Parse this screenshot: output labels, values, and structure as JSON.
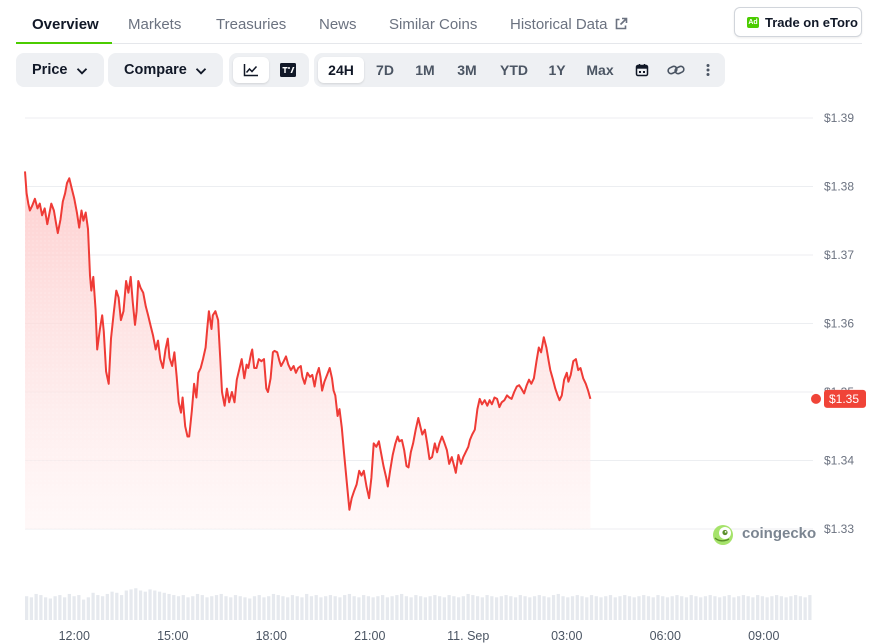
{
  "tabs": [
    {
      "label": "Overview",
      "active": true
    },
    {
      "label": "Markets",
      "active": false
    },
    {
      "label": "Treasuries",
      "active": false
    },
    {
      "label": "News",
      "active": false
    },
    {
      "label": "Similar Coins",
      "active": false
    },
    {
      "label": "Historical Data",
      "active": false
    }
  ],
  "ad_badge": "Ad",
  "cta_label": "Trade on eToro",
  "toolbar": {
    "price_label": "Price",
    "compare_label": "Compare",
    "chart_modes": [
      "line-chart-icon",
      "tradingview-icon"
    ],
    "ranges": [
      "24H",
      "7D",
      "1M",
      "3M",
      "YTD",
      "1Y",
      "Max"
    ],
    "active_range": "24H",
    "tools": [
      "calendar-icon",
      "link-icon",
      "more-icon"
    ]
  },
  "watermark": "coingecko",
  "colors": {
    "accent_green": "#4bcc00",
    "line_red": "#ef3b36",
    "badge_red": "#f04438"
  },
  "chart_data": {
    "type": "area",
    "current_price_label": "$1.35",
    "current_price": 1.349,
    "ylim": [
      1.33,
      1.39
    ],
    "y_ticks": [
      {
        "value": 1.39,
        "label": "$1.39"
      },
      {
        "value": 1.38,
        "label": "$1.38"
      },
      {
        "value": 1.37,
        "label": "$1.37"
      },
      {
        "value": 1.36,
        "label": "$1.36"
      },
      {
        "value": 1.35,
        "label": "$1.35"
      },
      {
        "value": 1.34,
        "label": "$1.34"
      },
      {
        "value": 1.33,
        "label": "$1.33"
      }
    ],
    "x_ticks": [
      {
        "t": 0.0,
        "label": "12:00"
      },
      {
        "t": 3.0,
        "label": "15:00"
      },
      {
        "t": 6.0,
        "label": "18:00"
      },
      {
        "t": 9.0,
        "label": "21:00"
      },
      {
        "t": 12.0,
        "label": "11. Sep"
      },
      {
        "t": 15.0,
        "label": "03:00"
      },
      {
        "t": 18.0,
        "label": "06:00"
      },
      {
        "t": 21.0,
        "label": "09:00"
      }
    ],
    "x_range": [
      -1.5,
      22.5
    ],
    "series": [
      {
        "values": [
          [
            -1.5,
            1.3822
          ],
          [
            -1.45,
            1.379
          ],
          [
            -1.4,
            1.3775
          ],
          [
            -1.35,
            1.3765
          ],
          [
            -1.28,
            1.3772
          ],
          [
            -1.2,
            1.3782
          ],
          [
            -1.12,
            1.3768
          ],
          [
            -1.05,
            1.3775
          ],
          [
            -0.98,
            1.3758
          ],
          [
            -0.9,
            1.3768
          ],
          [
            -0.82,
            1.3745
          ],
          [
            -0.76,
            1.376
          ],
          [
            -0.7,
            1.3775
          ],
          [
            -0.62,
            1.3765
          ],
          [
            -0.55,
            1.3745
          ],
          [
            -0.5,
            1.3732
          ],
          [
            -0.42,
            1.3752
          ],
          [
            -0.35,
            1.3778
          ],
          [
            -0.28,
            1.379
          ],
          [
            -0.22,
            1.3805
          ],
          [
            -0.15,
            1.3812
          ],
          [
            -0.08,
            1.3798
          ],
          [
            0.0,
            1.3782
          ],
          [
            0.08,
            1.3762
          ],
          [
            0.15,
            1.374
          ],
          [
            0.22,
            1.3765
          ],
          [
            0.28,
            1.375
          ],
          [
            0.35,
            1.3762
          ],
          [
            0.42,
            1.3738
          ],
          [
            0.48,
            1.367
          ],
          [
            0.52,
            1.3648
          ],
          [
            0.58,
            1.3668
          ],
          [
            0.65,
            1.362
          ],
          [
            0.7,
            1.3562
          ],
          [
            0.78,
            1.3592
          ],
          [
            0.85,
            1.3612
          ],
          [
            0.9,
            1.3588
          ],
          [
            0.97,
            1.353
          ],
          [
            1.05,
            1.3512
          ],
          [
            1.12,
            1.3578
          ],
          [
            1.2,
            1.3615
          ],
          [
            1.28,
            1.3648
          ],
          [
            1.35,
            1.3638
          ],
          [
            1.42,
            1.3605
          ],
          [
            1.5,
            1.3618
          ],
          [
            1.58,
            1.3662
          ],
          [
            1.65,
            1.3645
          ],
          [
            1.72,
            1.3668
          ],
          [
            1.78,
            1.3632
          ],
          [
            1.85,
            1.3598
          ],
          [
            1.9,
            1.3618
          ],
          [
            1.95,
            1.3662
          ],
          [
            2.02,
            1.3652
          ],
          [
            2.1,
            1.3645
          ],
          [
            2.18,
            1.3625
          ],
          [
            2.25,
            1.3612
          ],
          [
            2.32,
            1.3598
          ],
          [
            2.4,
            1.3582
          ],
          [
            2.48,
            1.3562
          ],
          [
            2.55,
            1.3575
          ],
          [
            2.62,
            1.3548
          ],
          [
            2.7,
            1.3535
          ],
          [
            2.78,
            1.3562
          ],
          [
            2.85,
            1.3578
          ],
          [
            2.9,
            1.355
          ],
          [
            2.98,
            1.3538
          ],
          [
            3.05,
            1.3558
          ],
          [
            3.12,
            1.3522
          ],
          [
            3.18,
            1.3485
          ],
          [
            3.25,
            1.347
          ],
          [
            3.3,
            1.3492
          ],
          [
            3.38,
            1.345
          ],
          [
            3.45,
            1.3435
          ],
          [
            3.5,
            1.3435
          ],
          [
            3.58,
            1.3472
          ],
          [
            3.65,
            1.3512
          ],
          [
            3.72,
            1.3492
          ],
          [
            3.78,
            1.3528
          ],
          [
            3.85,
            1.3535
          ],
          [
            3.92,
            1.3548
          ],
          [
            4.0,
            1.3565
          ],
          [
            4.05,
            1.3592
          ],
          [
            4.1,
            1.3618
          ],
          [
            4.18,
            1.3592
          ],
          [
            4.22,
            1.3612
          ],
          [
            4.3,
            1.3618
          ],
          [
            4.38,
            1.3605
          ],
          [
            4.45,
            1.3545
          ],
          [
            4.5,
            1.35
          ],
          [
            4.58,
            1.348
          ],
          [
            4.65,
            1.3505
          ],
          [
            4.72,
            1.3485
          ],
          [
            4.8,
            1.35
          ],
          [
            4.88,
            1.3485
          ],
          [
            4.95,
            1.3518
          ],
          [
            5.02,
            1.3532
          ],
          [
            5.1,
            1.3548
          ],
          [
            5.18,
            1.352
          ],
          [
            5.25,
            1.354
          ],
          [
            5.3,
            1.3535
          ],
          [
            5.38,
            1.3555
          ],
          [
            5.42,
            1.3562
          ],
          [
            5.48,
            1.3535
          ],
          [
            5.55,
            1.3535
          ],
          [
            5.62,
            1.3548
          ],
          [
            5.7,
            1.3545
          ],
          [
            5.78,
            1.3548
          ],
          [
            5.85,
            1.3505
          ],
          [
            5.9,
            1.35
          ],
          [
            5.98,
            1.352
          ],
          [
            6.05,
            1.3558
          ],
          [
            6.1,
            1.356
          ],
          [
            6.18,
            1.3558
          ],
          [
            6.25,
            1.3545
          ],
          [
            6.3,
            1.3538
          ],
          [
            6.38,
            1.3545
          ],
          [
            6.45,
            1.3552
          ],
          [
            6.52,
            1.354
          ],
          [
            6.6,
            1.3532
          ],
          [
            6.68,
            1.3538
          ],
          [
            6.75,
            1.3528
          ],
          [
            6.82,
            1.3535
          ],
          [
            6.9,
            1.3538
          ],
          [
            6.95,
            1.3522
          ],
          [
            7.02,
            1.3512
          ],
          [
            7.1,
            1.3528
          ],
          [
            7.18,
            1.3522
          ],
          [
            7.25,
            1.3525
          ],
          [
            7.32,
            1.3508
          ],
          [
            7.38,
            1.3525
          ],
          [
            7.45,
            1.3535
          ],
          [
            7.5,
            1.3522
          ],
          [
            7.55,
            1.3502
          ],
          [
            7.62,
            1.3515
          ],
          [
            7.7,
            1.3525
          ],
          [
            7.78,
            1.3535
          ],
          [
            7.85,
            1.352
          ],
          [
            7.9,
            1.3502
          ],
          [
            7.95,
            1.3495
          ],
          [
            8.02,
            1.3465
          ],
          [
            8.08,
            1.3475
          ],
          [
            8.15,
            1.3448
          ],
          [
            8.22,
            1.341
          ],
          [
            8.3,
            1.3368
          ],
          [
            8.38,
            1.3328
          ],
          [
            8.45,
            1.3345
          ],
          [
            8.52,
            1.3355
          ],
          [
            8.6,
            1.3365
          ],
          [
            8.68,
            1.3385
          ],
          [
            8.75,
            1.3378
          ],
          [
            8.82,
            1.3385
          ],
          [
            8.9,
            1.3362
          ],
          [
            8.98,
            1.3345
          ],
          [
            9.05,
            1.3375
          ],
          [
            9.12,
            1.3425
          ],
          [
            9.2,
            1.342
          ],
          [
            9.28,
            1.3428
          ],
          [
            9.35,
            1.341
          ],
          [
            9.42,
            1.3392
          ],
          [
            9.5,
            1.3375
          ],
          [
            9.55,
            1.3362
          ],
          [
            9.62,
            1.3385
          ],
          [
            9.7,
            1.3408
          ],
          [
            9.78,
            1.3425
          ],
          [
            9.85,
            1.3435
          ],
          [
            9.9,
            1.3428
          ],
          [
            9.98,
            1.343
          ],
          [
            10.05,
            1.3415
          ],
          [
            10.12,
            1.3392
          ],
          [
            10.18,
            1.339
          ],
          [
            10.25,
            1.3412
          ],
          [
            10.32,
            1.3425
          ],
          [
            10.4,
            1.3445
          ],
          [
            10.48,
            1.3462
          ],
          [
            10.55,
            1.3448
          ],
          [
            10.6,
            1.3438
          ],
          [
            10.68,
            1.3445
          ],
          [
            10.75,
            1.3425
          ],
          [
            10.82,
            1.3402
          ],
          [
            10.9,
            1.3405
          ],
          [
            10.98,
            1.3425
          ],
          [
            11.05,
            1.3412
          ],
          [
            11.12,
            1.3425
          ],
          [
            11.2,
            1.3435
          ],
          [
            11.28,
            1.3425
          ],
          [
            11.35,
            1.3415
          ],
          [
            11.42,
            1.3395
          ],
          [
            11.5,
            1.3405
          ],
          [
            11.58,
            1.339
          ],
          [
            11.62,
            1.3382
          ],
          [
            11.7,
            1.3408
          ],
          [
            11.78,
            1.3395
          ],
          [
            11.85,
            1.3405
          ],
          [
            11.92,
            1.3412
          ],
          [
            12.0,
            1.342
          ],
          [
            12.05,
            1.343
          ],
          [
            12.12,
            1.3438
          ],
          [
            12.2,
            1.3445
          ],
          [
            12.28,
            1.3475
          ],
          [
            12.35,
            1.349
          ],
          [
            12.42,
            1.3482
          ],
          [
            12.5,
            1.3488
          ],
          [
            12.58,
            1.348
          ],
          [
            12.65,
            1.3488
          ],
          [
            12.72,
            1.3482
          ],
          [
            12.8,
            1.3492
          ],
          [
            12.88,
            1.349
          ],
          [
            12.95,
            1.3478
          ],
          [
            13.02,
            1.3485
          ],
          [
            13.1,
            1.3488
          ],
          [
            13.18,
            1.3495
          ],
          [
            13.25,
            1.3492
          ],
          [
            13.32,
            1.349
          ],
          [
            13.4,
            1.35
          ],
          [
            13.48,
            1.3508
          ],
          [
            13.55,
            1.351
          ],
          [
            13.62,
            1.3505
          ],
          [
            13.7,
            1.3498
          ],
          [
            13.78,
            1.351
          ],
          [
            13.85,
            1.3518
          ],
          [
            13.92,
            1.3512
          ],
          [
            14.0,
            1.352
          ],
          [
            14.08,
            1.3545
          ],
          [
            14.15,
            1.3565
          ],
          [
            14.22,
            1.3558
          ],
          [
            14.3,
            1.358
          ],
          [
            14.38,
            1.3565
          ],
          [
            14.45,
            1.3545
          ],
          [
            14.5,
            1.3532
          ],
          [
            14.58,
            1.3518
          ],
          [
            14.65,
            1.3505
          ],
          [
            14.72,
            1.3495
          ],
          [
            14.78,
            1.3488
          ],
          [
            14.85,
            1.3495
          ],
          [
            14.92,
            1.3518
          ],
          [
            15.0,
            1.3528
          ],
          [
            15.05,
            1.3515
          ],
          [
            15.12,
            1.3525
          ],
          [
            15.2,
            1.3545
          ],
          [
            15.28,
            1.3548
          ],
          [
            15.35,
            1.3532
          ],
          [
            15.42,
            1.3535
          ],
          [
            15.5,
            1.352
          ],
          [
            15.58,
            1.3512
          ],
          [
            15.65,
            1.3502
          ],
          [
            15.72,
            1.349
          ]
        ]
      }
    ],
    "volume": [
      2.1,
      2.0,
      2.3,
      2.2,
      2.0,
      1.9,
      2.1,
      2.2,
      2.0,
      2.3,
      2.1,
      2.2,
      1.8,
      2.0,
      2.4,
      2.2,
      2.1,
      2.3,
      2.5,
      2.4,
      2.2,
      2.6,
      2.7,
      2.8,
      2.6,
      2.5,
      2.7,
      2.6,
      2.5,
      2.4,
      2.3,
      2.2,
      2.1,
      2.2,
      2.0,
      2.1,
      2.3,
      2.2,
      2.0,
      2.1,
      2.2,
      2.3,
      2.1,
      2.0,
      2.2,
      2.1,
      2.0,
      1.9,
      2.1,
      2.2,
      2.0,
      2.1,
      2.3,
      2.2,
      2.1,
      2.0,
      2.2,
      2.1,
      2.0,
      2.3,
      2.1,
      2.2,
      2.0,
      2.1,
      2.2,
      2.1,
      2.0,
      2.2,
      2.3,
      2.1,
      2.0,
      2.2,
      2.1,
      2.0,
      2.1,
      2.2,
      2.0,
      2.1,
      2.2,
      2.3,
      2.1,
      2.0,
      2.2,
      2.1,
      2.0,
      2.1,
      2.2,
      2.1,
      2.0,
      2.2,
      2.1,
      2.0,
      2.1,
      2.3,
      2.2,
      2.1,
      2.0,
      2.2,
      2.1,
      2.0,
      2.1,
      2.2,
      2.1,
      2.0,
      2.2,
      2.1,
      2.0,
      2.1,
      2.2,
      2.1,
      2.0,
      2.2,
      2.3,
      2.1,
      2.0,
      2.1,
      2.2,
      2.1,
      2.0,
      2.2,
      2.1,
      2.0,
      2.1,
      2.2,
      2.0,
      2.1,
      2.2,
      2.1,
      2.0,
      2.1,
      2.2,
      2.1,
      2.0,
      2.2,
      2.1,
      2.0,
      2.1,
      2.2,
      2.1,
      2.0,
      2.2,
      2.1,
      2.0,
      2.1,
      2.2,
      2.1,
      2.0,
      2.1,
      2.2,
      2.0,
      2.1,
      2.2,
      2.1,
      2.0,
      2.2,
      2.1,
      2.0,
      2.1,
      2.2,
      2.1,
      2.0,
      2.1,
      2.2,
      2.1,
      2.0,
      2.2
    ]
  }
}
